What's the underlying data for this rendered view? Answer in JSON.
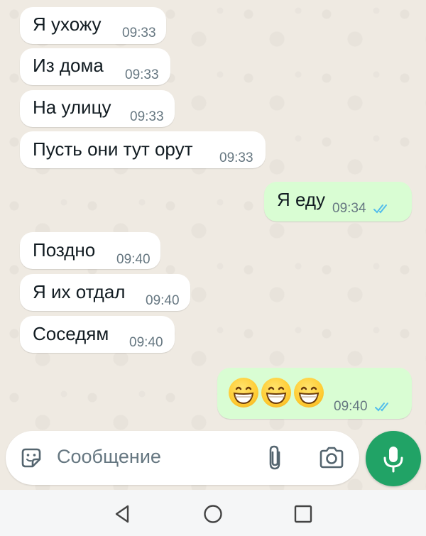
{
  "messages": [
    {
      "direction": "in",
      "text": "Я ухожу",
      "time": "09:33"
    },
    {
      "direction": "in",
      "text": "Из дома",
      "time": "09:33"
    },
    {
      "direction": "in",
      "text": "На улицу",
      "time": "09:33"
    },
    {
      "direction": "in",
      "text": "Пусть они тут орут",
      "time": "09:33"
    },
    {
      "direction": "out",
      "text": "Я еду",
      "time": "09:34",
      "read": true
    },
    {
      "direction": "in",
      "text": "Поздно",
      "time": "09:40"
    },
    {
      "direction": "in",
      "text": "Я их отдал",
      "time": "09:40"
    },
    {
      "direction": "in",
      "text": "Соседям",
      "time": "09:40"
    },
    {
      "direction": "out",
      "emoji": [
        "grinning-face-with-smiling-eyes",
        "grinning-face-with-smiling-eyes",
        "grinning-face-with-smiling-eyes"
      ],
      "time": "09:40",
      "read": true
    }
  ],
  "composer": {
    "placeholder": "Сообщение",
    "icons": [
      "sticker-icon",
      "attach-icon",
      "camera-icon",
      "mic-icon"
    ]
  },
  "navbar": {
    "icons": [
      "back-icon",
      "home-icon",
      "recents-icon"
    ]
  },
  "colors": {
    "background": "#efeae2",
    "incoming_bubble": "#ffffff",
    "outgoing_bubble": "#d9fdd3",
    "read_ticks": "#53bdeb",
    "mic_button": "#21a366",
    "timestamp": "#667781"
  }
}
